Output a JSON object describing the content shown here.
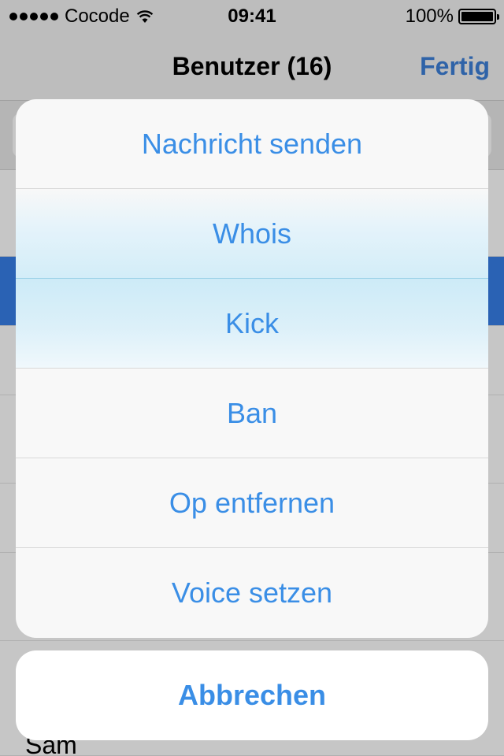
{
  "status_bar": {
    "carrier": "Cocode",
    "time": "09:41",
    "battery": "100%"
  },
  "nav": {
    "title": "Benutzer (16)",
    "done_label": "Fertig"
  },
  "background_list": {
    "visible_name": "Sam"
  },
  "action_sheet": {
    "items": [
      {
        "label": "Nachricht senden"
      },
      {
        "label": "Whois"
      },
      {
        "label": "Kick"
      },
      {
        "label": "Ban"
      },
      {
        "label": "Op entfernen"
      },
      {
        "label": "Voice setzen"
      }
    ],
    "cancel_label": "Abbrechen"
  },
  "colors": {
    "action_text": "#3a8ee6",
    "highlight": "#d3edf8",
    "dim_background": "#c6c6c6",
    "selected_row": "#2a62b4"
  }
}
